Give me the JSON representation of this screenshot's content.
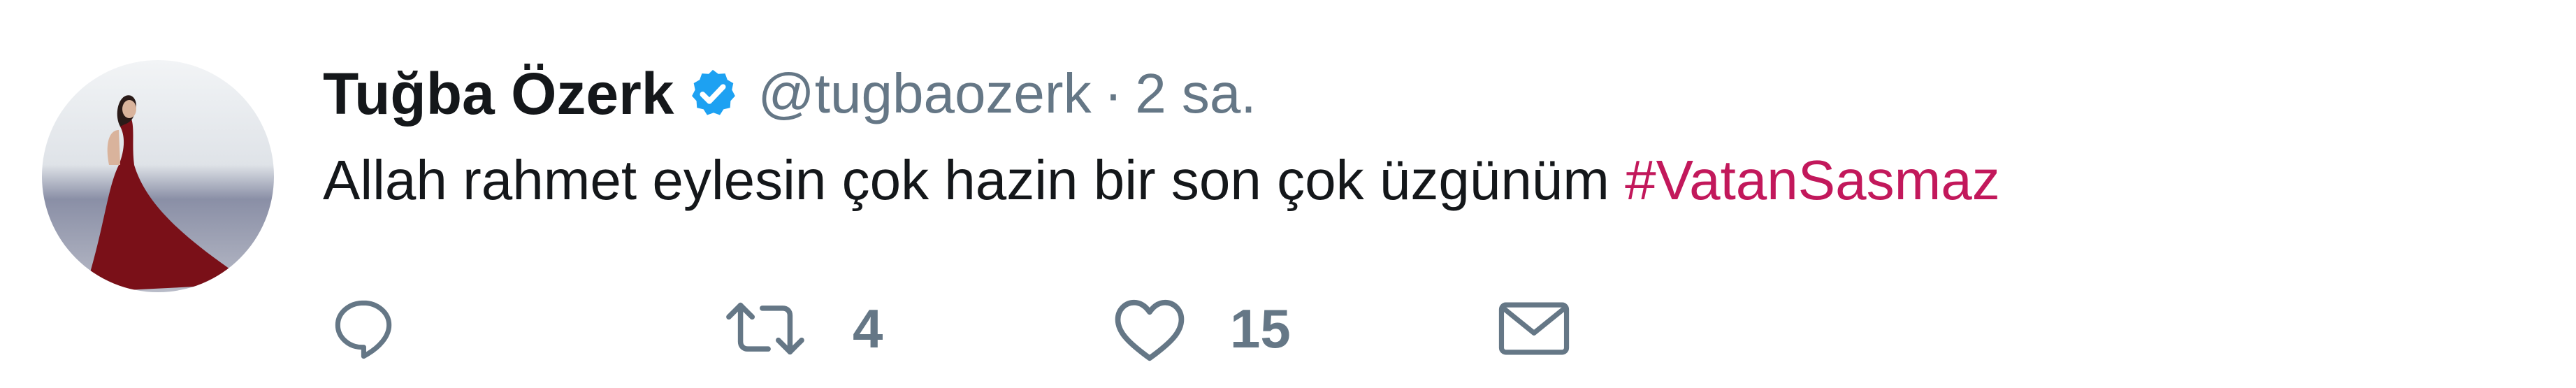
{
  "tweet": {
    "author": {
      "display_name": "Tuğba Özerk",
      "handle": "@tugbaozerk",
      "verified": true,
      "avatar_signature": "Tuğba Özerk"
    },
    "separator": "·",
    "time": "2 sa.",
    "text": "Allah rahmet eylesin çok hazin bir son çok üzgünüm ",
    "hashtag": "#VatanSasmaz",
    "actions": {
      "reply_icon": "reply-icon",
      "retweet_icon": "retweet-icon",
      "retweet_count": "4",
      "like_icon": "heart-icon",
      "like_count": "15",
      "dm_icon": "envelope-icon"
    }
  },
  "colors": {
    "text": "#14171a",
    "secondary": "#657786",
    "verified": "#1da1f2",
    "hashtag": "#c2185b",
    "icon": "#657786"
  }
}
